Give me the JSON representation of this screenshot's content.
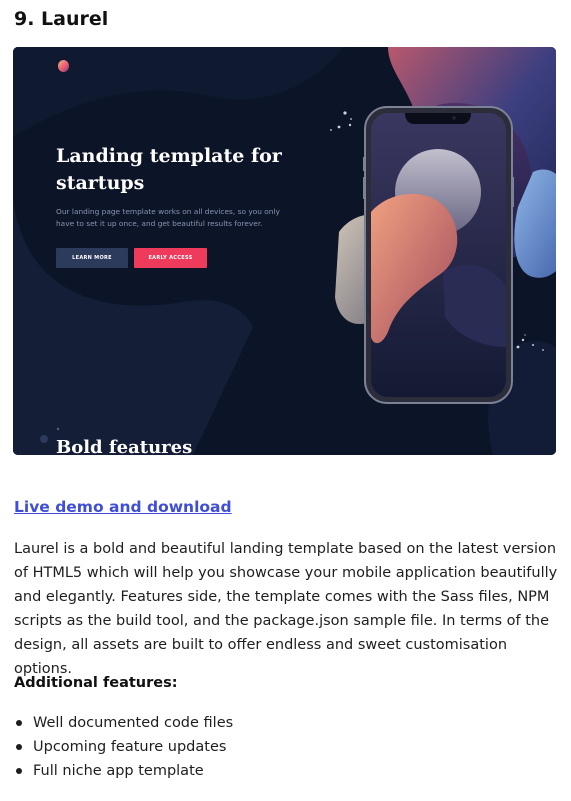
{
  "article": {
    "heading": "9. Laurel",
    "link_label": "Live demo and download",
    "description": "Laurel is a bold and beautiful landing template based on the latest version of HTML5 which will help you showcase your mobile application beautifully and elegantly. Features side, the template comes with the Sass files, NPM scripts as the build tool, and the package.json sample file. In terms of the design, all assets are built to offer endless and sweet customisation options.",
    "features_heading": "Additional features:",
    "features": [
      "Well documented code files",
      "Upcoming feature updates",
      "Full niche app template"
    ]
  },
  "preview": {
    "title": "Landing template for startups",
    "subtitle": "Our landing page template works on all devices, so you only have to set it up once, and get beautiful results forever.",
    "learn_more_label": "LEARN MORE",
    "early_access_label": "EARLY ACCESS",
    "section_peek": "Bold features",
    "colors": {
      "background": "#0c1427",
      "accent": "#ee3b5c",
      "secondary_button": "#2c3a5c",
      "link": "#3e4ed6"
    }
  }
}
